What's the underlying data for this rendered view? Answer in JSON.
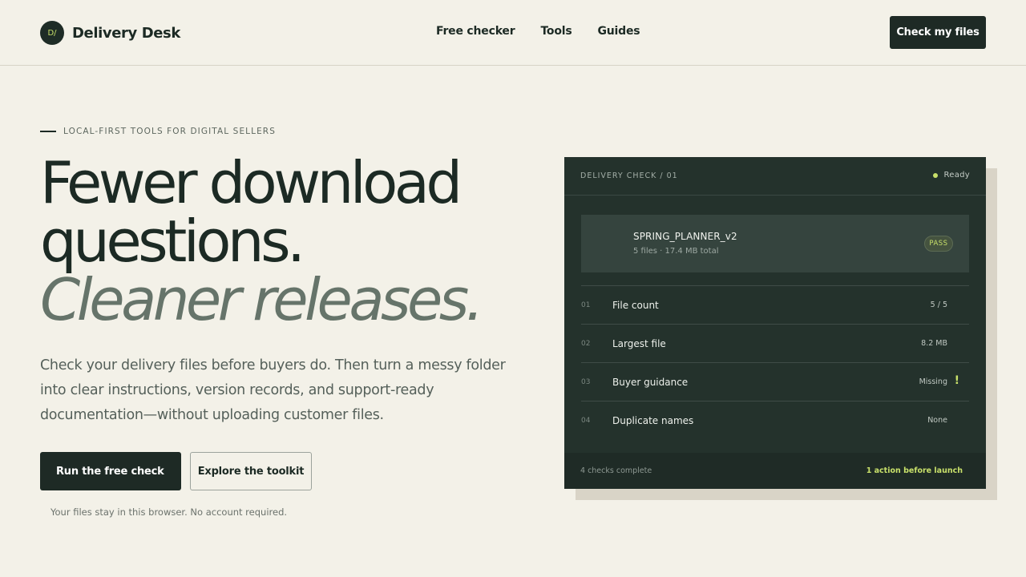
{
  "brand": {
    "mark": "D/",
    "name": "Delivery Desk"
  },
  "nav": {
    "items": [
      "Free checker",
      "Tools",
      "Guides"
    ],
    "cta": "Check my files"
  },
  "hero": {
    "eyebrow": "LOCAL-FIRST TOOLS FOR DIGITAL SELLERS",
    "headline_line1": "Fewer download",
    "headline_line2": "questions.",
    "headline_line3": "Cleaner releases.",
    "lede": "Check your delivery files before buyers do. Then turn a messy folder into clear instructions, version records, and support-ready documentation—without uploading customer files.",
    "primary_button": "Run the free check",
    "secondary_button": "Explore the toolkit",
    "note": "Your files stay in this browser. No account required."
  },
  "panel": {
    "title": "DELIVERY CHECK / 01",
    "status": "Ready",
    "file": {
      "name": "SPRING_PLANNER_v2",
      "meta": "5 files · 17.4 MB total",
      "badge": "PASS"
    },
    "checks": [
      {
        "num": "01",
        "label": "File count",
        "value": "5 / 5",
        "warn": ""
      },
      {
        "num": "02",
        "label": "Largest file",
        "value": "8.2 MB",
        "warn": ""
      },
      {
        "num": "03",
        "label": "Buyer guidance",
        "value": "Missing",
        "warn": "!"
      },
      {
        "num": "04",
        "label": "Duplicate names",
        "value": "None",
        "warn": ""
      }
    ],
    "footer_left": "4 checks complete",
    "footer_right": "1 action before launch"
  },
  "colors": {
    "background": "#f3f1e8",
    "ink": "#1c2a24",
    "panel": "#24322c",
    "accent": "#c8e06a"
  }
}
